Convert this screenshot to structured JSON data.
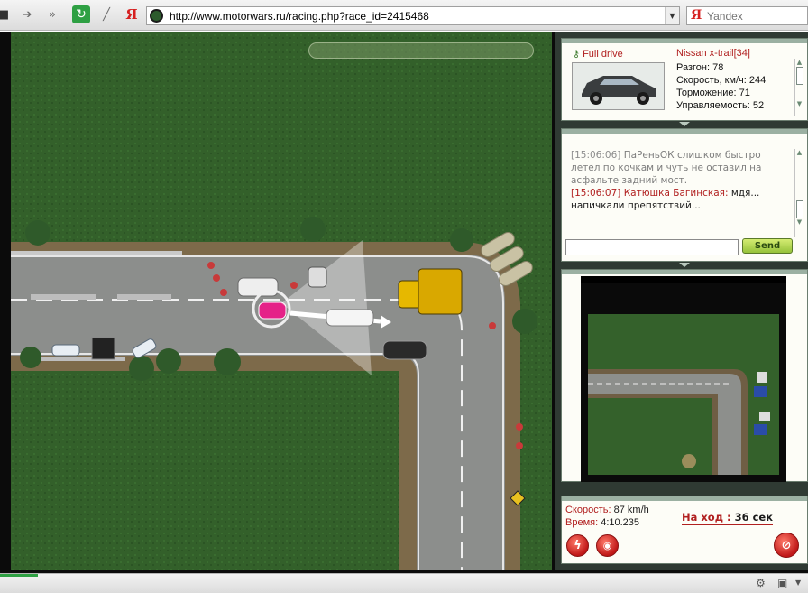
{
  "browser": {
    "url": "http://www.motorwars.ru/racing.php?race_id=2415468",
    "search_placeholder": "Yandex",
    "yandex_glyph": "Я"
  },
  "car_panel": {
    "drive_type": "Full drive",
    "car_name": "Nissan x-trail[34]",
    "stats": [
      "Разгон: 78",
      "Скорость, км/ч: 244",
      "Торможение: 71",
      "Управляемость: 52"
    ]
  },
  "chat": {
    "lines": [
      {
        "time": "[15:06:06]",
        "user": "ПаРеньОК",
        "text": " слишком быстро летел по кочкам и чуть не оставил на асфальте задний мост.",
        "style": "system"
      },
      {
        "time": "[15:06:07]",
        "user": "Катюшка Багинская:",
        "text": " мдя... напичкали препятствий...",
        "style": "user"
      }
    ],
    "input_value": "",
    "send_label": "Send"
  },
  "race_status": {
    "speed_label": "Скорость: ",
    "speed_value": "87 km/h",
    "time_label": "Время: ",
    "time_value": "4:10.235",
    "turn_label": "На ход : ",
    "turn_value": "36 сек"
  },
  "colors": {
    "accent_red": "#b12020",
    "send_green": "#96c23a",
    "grass": "#33602a",
    "asphalt": "#8c8e8c"
  },
  "icons": {
    "back": "stop-icon",
    "forward": "forward-icon",
    "reload": "reload-icon",
    "drive": "key-icon",
    "nitro": "lightning-icon",
    "signal": "signal-icon",
    "quit": "no-entry-icon"
  }
}
